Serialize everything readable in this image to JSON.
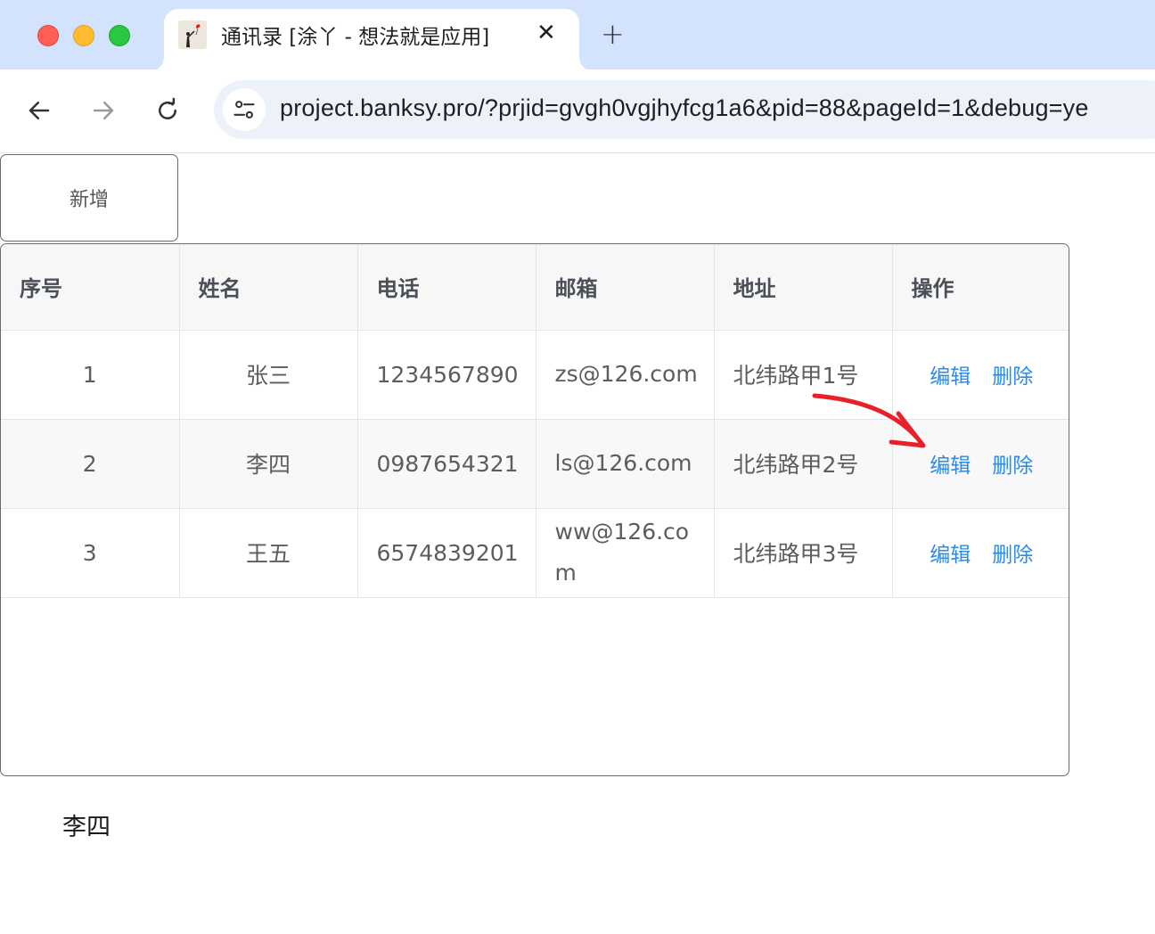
{
  "browser": {
    "tab_title": "通讯录 [涂丫 - 想法就是应用]",
    "tab_close_glyph": "✕",
    "new_tab_glyph": "+",
    "url": "project.banksy.pro/?prjid=gvgh0vgjhyfcg1a6&pid=88&pageId=1&debug=ye"
  },
  "page": {
    "add_button_label": "新增",
    "table": {
      "headers": [
        "序号",
        "姓名",
        "电话",
        "邮箱",
        "地址",
        "操作"
      ],
      "rows": [
        {
          "index": "1",
          "name": "张三",
          "phone": "1234567890",
          "email": "zs@126.com",
          "address": "北纬路甲1号",
          "edit": "编辑",
          "delete": "删除"
        },
        {
          "index": "2",
          "name": "李四",
          "phone": "0987654321",
          "email": "ls@126.com",
          "address": "北纬路甲2号",
          "edit": "编辑",
          "delete": "删除"
        },
        {
          "index": "3",
          "name": "王五",
          "phone": "6574839201",
          "email": "ww@126.com",
          "address": "北纬路甲3号",
          "edit": "编辑",
          "delete": "删除"
        }
      ]
    },
    "selected_name": "李四"
  },
  "colors": {
    "tabstrip_bg": "#d3e3fd",
    "link_blue": "#2b8be6",
    "annotation_arrow": "#e8202a"
  },
  "icons": [
    "back-arrow-icon",
    "forward-arrow-icon",
    "reload-icon",
    "site-info-icon",
    "close-icon",
    "plus-icon",
    "favicon"
  ]
}
